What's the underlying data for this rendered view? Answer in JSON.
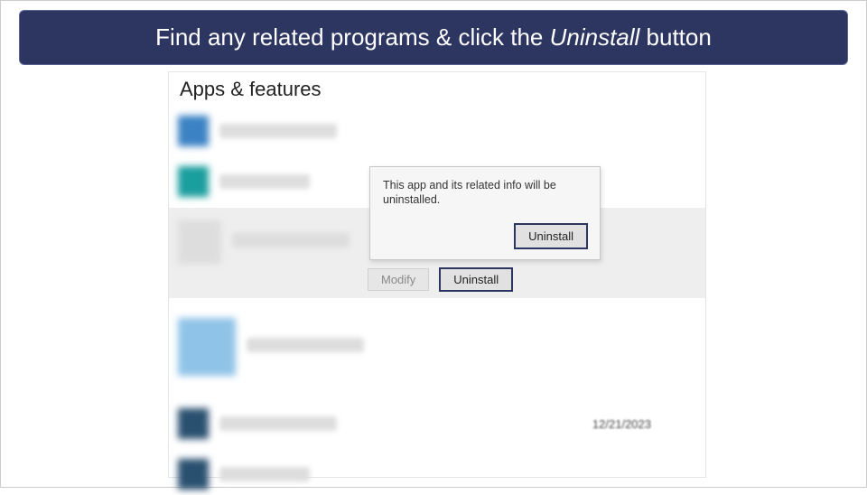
{
  "banner": {
    "prefix": "Find any related programs & click the ",
    "emphasis": "Uninstall",
    "suffix": " button"
  },
  "settings": {
    "title": "Apps & features",
    "modify_label": "Modify",
    "uninstall_label": "Uninstall",
    "popup": {
      "message": "This app and its related info will be uninstalled.",
      "confirm_label": "Uninstall"
    },
    "visible_date": "12/21/2023"
  }
}
